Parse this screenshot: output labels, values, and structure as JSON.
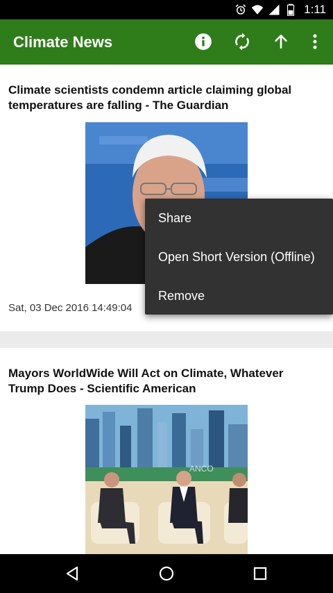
{
  "status_bar": {
    "time": "1:11",
    "icons": [
      "alarm-icon",
      "wifi-icon",
      "signal-icon",
      "battery-icon"
    ]
  },
  "app_bar": {
    "title": "Climate News",
    "actions": [
      "info-icon",
      "refresh-icon",
      "arrow-up-icon",
      "more-vert-icon"
    ],
    "color": "#2e7d1a"
  },
  "articles": [
    {
      "title": "Climate scientists condemn article claiming global temperatures are falling - The Guardian",
      "date": "Sat, 03 Dec 2016 14:49:04"
    },
    {
      "title": "Mayors WorldWide Will Act on Climate, Whatever Trump Does - Scientific American"
    }
  ],
  "popup_menu": {
    "items": [
      "Share",
      "Open Short Version (Offline)",
      "Remove"
    ]
  },
  "nav_bar": {
    "buttons": [
      "back-icon",
      "home-icon",
      "recents-icon"
    ]
  }
}
